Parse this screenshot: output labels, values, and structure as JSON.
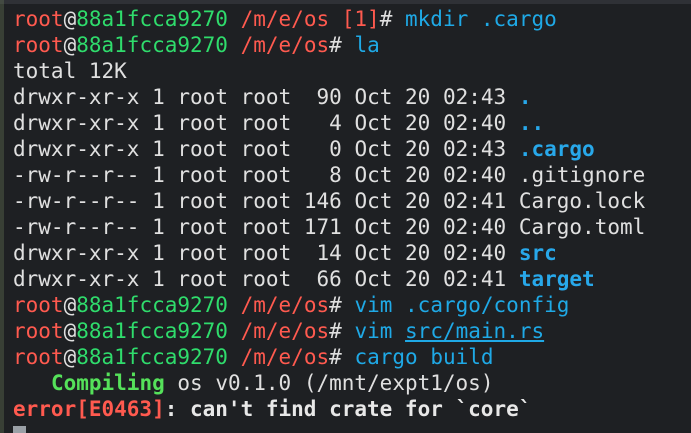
{
  "prompts": [
    {
      "user": "root",
      "at": "@",
      "host": "88a1fcca9270",
      "path": "/m/e/os",
      "status": " [1]",
      "sym": "#",
      "cmd": "mkdir",
      "arg": ".cargo"
    },
    {
      "user": "root",
      "at": "@",
      "host": "88a1fcca9270",
      "path": "/m/e/os",
      "sym": "#",
      "cmd": "la",
      "arg": ""
    },
    {
      "user": "root",
      "at": "@",
      "host": "88a1fcca9270",
      "path": "/m/e/os",
      "sym": "#",
      "cmd": "vim",
      "arg": ".cargo/config"
    },
    {
      "user": "root",
      "at": "@",
      "host": "88a1fcca9270",
      "path": "/m/e/os",
      "sym": "#",
      "cmd": "vim",
      "arg": "src/main.rs"
    },
    {
      "user": "root",
      "at": "@",
      "host": "88a1fcca9270",
      "path": "/m/e/os",
      "sym": "#",
      "cmd": "cargo",
      "arg": "build"
    }
  ],
  "total": "total 12K",
  "listing": [
    {
      "perms": "drwxr-xr-x",
      "links": "1",
      "owner": "root",
      "group": "root",
      "size": " 90",
      "date": "Oct 20 02:43",
      "name": "."
    },
    {
      "perms": "drwxr-xr-x",
      "links": "1",
      "owner": "root",
      "group": "root",
      "size": "  4",
      "date": "Oct 20 02:40",
      "name": ".."
    },
    {
      "perms": "drwxr-xr-x",
      "links": "1",
      "owner": "root",
      "group": "root",
      "size": "  0",
      "date": "Oct 20 02:43",
      "name": ".cargo"
    },
    {
      "perms": "-rw-r--r--",
      "links": "1",
      "owner": "root",
      "group": "root",
      "size": "  8",
      "date": "Oct 20 02:40",
      "name": ".gitignore"
    },
    {
      "perms": "-rw-r--r--",
      "links": "1",
      "owner": "root",
      "group": "root",
      "size": "146",
      "date": "Oct 20 02:41",
      "name": "Cargo.lock"
    },
    {
      "perms": "-rw-r--r--",
      "links": "1",
      "owner": "root",
      "group": "root",
      "size": "171",
      "date": "Oct 20 02:40",
      "name": "Cargo.toml"
    },
    {
      "perms": "drwxr-xr-x",
      "links": "1",
      "owner": "root",
      "group": "root",
      "size": " 14",
      "date": "Oct 20 02:40",
      "name": "src"
    },
    {
      "perms": "drwxr-xr-x",
      "links": "1",
      "owner": "root",
      "group": "root",
      "size": " 66",
      "date": "Oct 20 02:41",
      "name": "target"
    }
  ],
  "build": {
    "compiling_label": "Compiling",
    "compiling_text": "os v0.1.0 (/mnt/expt1/os)",
    "error_label": "error[E0463]",
    "error_text": ": can't find crate for `core`"
  }
}
